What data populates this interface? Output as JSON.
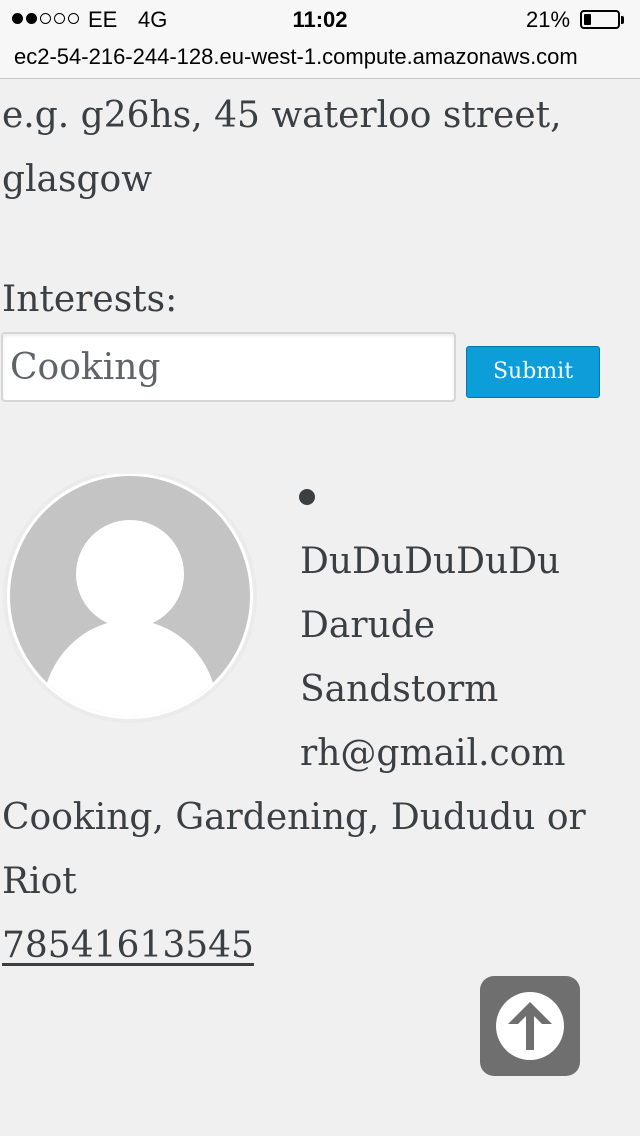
{
  "status_bar": {
    "signal_strength": "2 of 5 dots",
    "carrier": "EE",
    "network": "4G",
    "time": "11:02",
    "battery_percent": "21%",
    "battery_level": 0.21
  },
  "browser": {
    "url": "ec2-54-216-244-128.eu-west-1.compute.amazonaws.com"
  },
  "form": {
    "location_hint": "e.g. g26hs, 45 waterloo street, glasgow",
    "interests_label": "Interests:",
    "interests_value": "Cooking",
    "submit_label": "Submit"
  },
  "result": {
    "username": "DuDuDuDuDu",
    "first_name": "Darude",
    "last_name": "Sandstorm",
    "email": "rh@gmail.com",
    "interests": "Cooking, Gardening, Dududu or Riot",
    "phone": "78541613545"
  },
  "icons": {
    "avatar": "default-user-avatar-icon",
    "back_to_top": "arrow-up-circle-icon"
  },
  "colors": {
    "page_background": "#f0f0f0",
    "text": "#3a3f44",
    "submit_button": "#0d9ed9",
    "back_to_top_button": "#6f6f6f",
    "avatar_gray": "#c4c4c4"
  }
}
